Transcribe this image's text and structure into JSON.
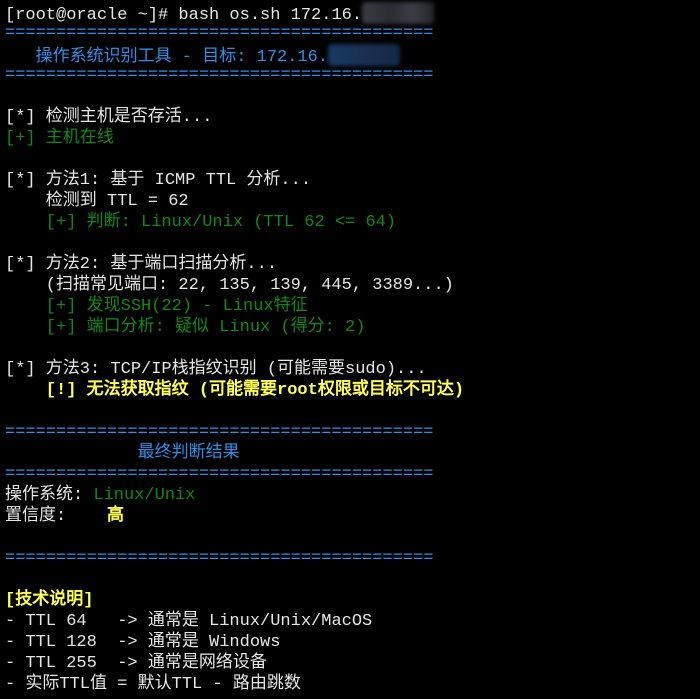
{
  "terminal": {
    "lines": [
      [
        {
          "t": "[*] ...",
          "c": "w"
        }
      ],
      [
        {
          "t": "[root@oracle ~]# bash os.sh 172.16.",
          "c": "w"
        },
        {
          "blur": "gray"
        }
      ],
      [
        {
          "t": "==========================================",
          "c": "b"
        }
      ],
      [
        {
          "t": "   操作系统识别工具 - 目标: 172.16.",
          "c": "b"
        },
        {
          "blur": "blue"
        }
      ],
      [
        {
          "t": "==========================================",
          "c": "b"
        }
      ],
      [],
      [
        {
          "t": "[*] 检测主机是否存活...",
          "c": "w"
        }
      ],
      [
        {
          "t": "[+] 主机在线",
          "c": "g"
        }
      ],
      [],
      [
        {
          "t": "[*] 方法1: 基于 ICMP TTL 分析...",
          "c": "w"
        }
      ],
      [
        {
          "t": "    检测到 TTL = 62",
          "c": "w"
        }
      ],
      [
        {
          "t": "    [+] 判断: Linux/Unix (TTL 62 <= 64)",
          "c": "g"
        }
      ],
      [],
      [
        {
          "t": "[*] 方法2: 基于端口扫描分析...",
          "c": "w"
        }
      ],
      [
        {
          "t": "    (扫描常见端口: 22, 135, 139, 445, 3389...)",
          "c": "w"
        }
      ],
      [
        {
          "t": "    [+] 发现SSH(22) - Linux特征",
          "c": "g"
        }
      ],
      [
        {
          "t": "    [+] 端口分析: 疑似 Linux (得分: 2)",
          "c": "g"
        }
      ],
      [],
      [
        {
          "t": "[*] 方法3: TCP/IP栈指纹识别 (可能需要sudo)...",
          "c": "w"
        }
      ],
      [
        {
          "t": "    [!] 无法获取指纹 (可能需要root权限或目标不可达)",
          "c": "y"
        }
      ],
      [],
      [
        {
          "t": "==========================================",
          "c": "b"
        }
      ],
      [
        {
          "t": "             最终判断结果",
          "c": "b"
        }
      ],
      [
        {
          "t": "==========================================",
          "c": "b"
        }
      ],
      [
        {
          "t": "操作系统: ",
          "c": "w"
        },
        {
          "t": "Linux/Unix",
          "c": "g"
        }
      ],
      [
        {
          "t": "置信度:    ",
          "c": "w"
        },
        {
          "t": "高",
          "c": "y"
        }
      ],
      [],
      [
        {
          "t": "==========================================",
          "c": "b"
        }
      ],
      [],
      [
        {
          "t": "[技术说明]",
          "c": "y"
        }
      ],
      [
        {
          "t": "- TTL 64   -> 通常是 Linux/Unix/MacOS",
          "c": "w"
        }
      ],
      [
        {
          "t": "- TTL 128  -> 通常是 Windows",
          "c": "w"
        }
      ],
      [
        {
          "t": "- TTL 255  -> 通常是网络设备",
          "c": "w"
        }
      ],
      [
        {
          "t": "- 实际TTL值 = 默认TTL - 路由跳数",
          "c": "w"
        }
      ]
    ]
  }
}
